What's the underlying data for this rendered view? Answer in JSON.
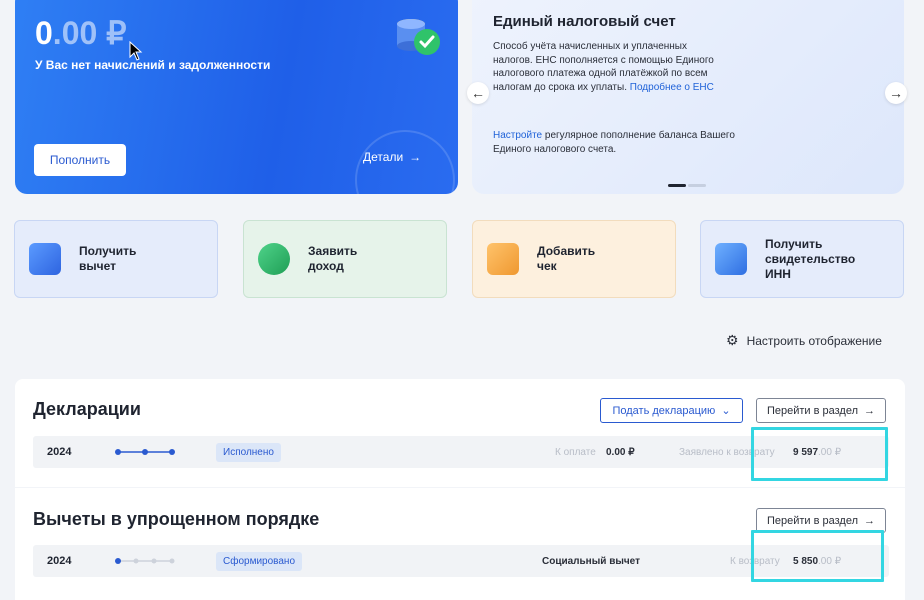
{
  "balance": {
    "amount_int": "0",
    "amount_dec": ".00 ₽",
    "subtitle": "У Вас нет начислений и задолженности",
    "topup_label": "Пополнить",
    "details_label": "Детали"
  },
  "ens": {
    "title": "Единый налоговый счет",
    "text": "Способ учёта начисленных и уплаченных налогов. ЕНС пополняется с помощью Единого налогового платежа одной платёжкой по всем налогам до срока их уплаты.",
    "more_link": "Подробнее о ЕНС",
    "setup_link": "Настройте",
    "setup_text": " регулярное пополнение баланса Вашего Единого налогового счета."
  },
  "actions": [
    {
      "label": "Получить\nвычет",
      "icon": "wallet-icon",
      "color": "#3d7df2"
    },
    {
      "label": "Заявить\nдоход",
      "icon": "ruble-coin-icon",
      "color": "#2fb667"
    },
    {
      "label": "Добавить\nчек",
      "icon": "receipt-icon",
      "color": "#f1a23c"
    },
    {
      "label": "Получить\nсвидетельство\nИНН",
      "icon": "monitor-icon",
      "color": "#3d7df2"
    }
  ],
  "settings_label": "Настроить отображение",
  "declarations": {
    "title": "Декларации",
    "submit_label": "Подать декларацию",
    "goto_label": "Перейти в раздел",
    "row": {
      "year": "2024",
      "status": "Исполнено",
      "pay_label": "К оплате",
      "pay_value": "0.00 ₽",
      "refund_label": "Заявлено к возврату",
      "refund_int": "9 597",
      "refund_dec": ".00 ₽"
    }
  },
  "deductions": {
    "title": "Вычеты в упрощенном порядке",
    "goto_label": "Перейти в раздел",
    "row": {
      "year": "2024",
      "status": "Сформировано",
      "type": "Социальный вычет",
      "refund_label": "К возврату",
      "refund_int": "5 850",
      "refund_dec": ".00 ₽"
    }
  },
  "colors": {
    "accent": "#2a5ad0",
    "highlight": "#33d6e2",
    "balance_card": "#1f5fe8"
  }
}
